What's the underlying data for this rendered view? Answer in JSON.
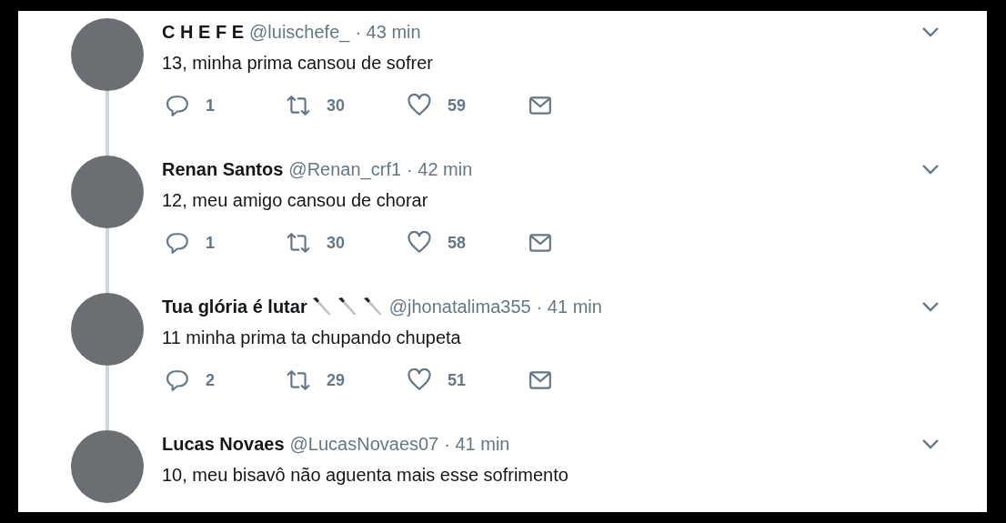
{
  "tweets": [
    {
      "name": "C H E F E",
      "handle": "@luischefe_",
      "time": "· 43 min",
      "text": "13, minha prima cansou de sofrer",
      "replies": "1",
      "retweets": "30",
      "likes": "59"
    },
    {
      "name": "Renan Santos",
      "handle": "@Renan_crf1",
      "time": "· 42 min",
      "text": "12, meu amigo cansou de chorar",
      "replies": "1",
      "retweets": "30",
      "likes": "58"
    },
    {
      "name": "Tua glória é lutar",
      "name_emojis": [
        {
          "kind": "knife"
        },
        {
          "kind": "knife"
        },
        {
          "kind": "knife"
        }
      ],
      "handle": "@jhonatalima355",
      "time": "· 41 min",
      "text": "11 minha prima ta chupando chupeta",
      "replies": "2",
      "retweets": "29",
      "likes": "51"
    },
    {
      "name": "Lucas Novaes",
      "handle": "@LucasNovaes07",
      "time": "· 41 min",
      "text": "10, meu bisavô não aguenta mais esse sofrimento"
    }
  ]
}
